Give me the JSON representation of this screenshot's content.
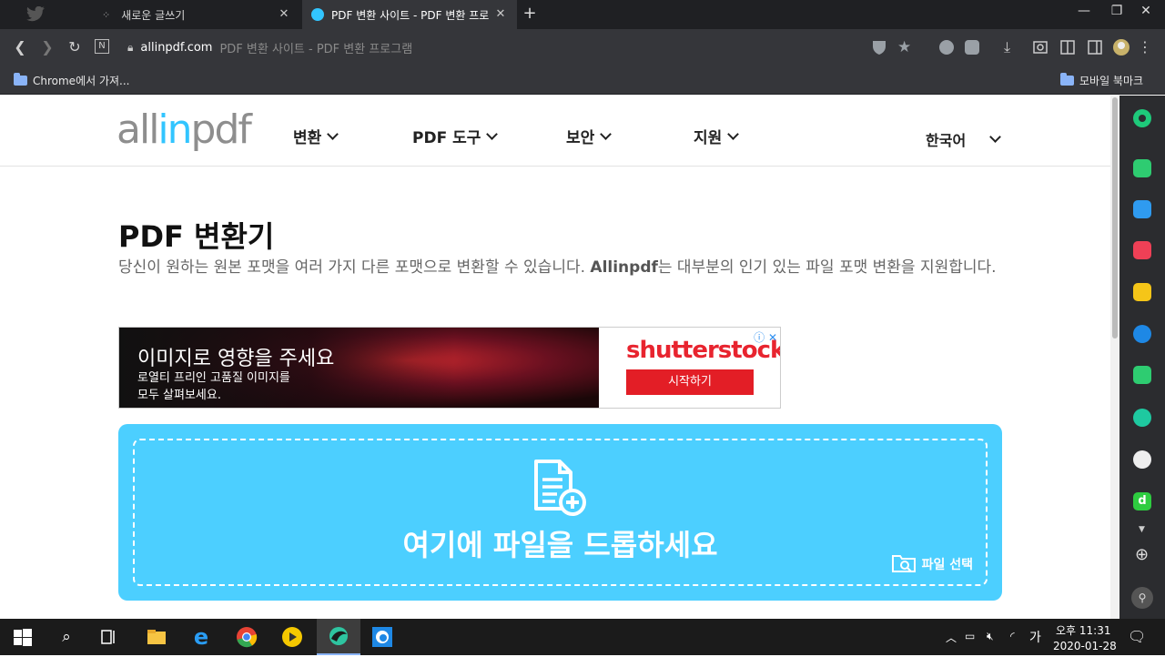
{
  "browser": {
    "tabs": [
      {
        "title": "새로운 글쓰기",
        "active": false
      },
      {
        "title": "PDF 변환 사이트 - PDF 변환 프로",
        "active": true
      }
    ],
    "url": "allinpdf.com",
    "page_title": "PDF 변환 사이트 - PDF 변환 프로그램",
    "bookmarks": {
      "left": "Chrome에서 가져...",
      "right": "모바일 북마크"
    }
  },
  "site": {
    "logo": {
      "part1": "all",
      "part2": "in",
      "part3": "pdf"
    },
    "nav": [
      "변환",
      "PDF 도구",
      "보안",
      "지원"
    ],
    "language": "한국어",
    "heading": "PDF 변환기",
    "description_1": "당신이 원하는 원본 포맷을 여러 가지 다른 포맷으로 변환할 수 있습니다. ",
    "description_bold": "Allinpdf",
    "description_2": "는 대부분의 인기 있는 파일 포맷 변환을 지원합니다.",
    "ad": {
      "headline": "이미지로 영향을 주세요",
      "sub1": "로열티 프리인 고품질 이미지를",
      "sub2": "모두 살펴보세요.",
      "brand": "shutterstock",
      "button": "시작하기"
    },
    "dropzone": {
      "text": "여기에 파일을 드롭하세요",
      "select_label": "파일 선택"
    }
  },
  "taskbar": {
    "ampm_time": "오후 11:31",
    "date": "2020-01-28",
    "ime": "가"
  },
  "colors": {
    "accent": "#4ccfff",
    "logo_blue": "#32c5ff",
    "ad_red": "#e31e26"
  }
}
